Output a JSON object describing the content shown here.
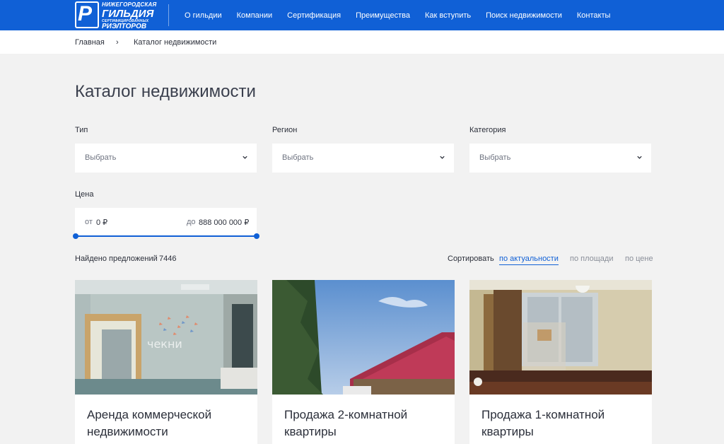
{
  "header": {
    "logo": {
      "mark": "P",
      "line1": "НИЖЕГОРОДСКАЯ",
      "line2": "ГИЛЬДИЯ",
      "line3": "СЕРТИФИЦИРОВАННЫХ",
      "line4": "РИЭЛТОРОВ"
    },
    "nav": [
      "О гильдии",
      "Компании",
      "Сертификация",
      "Преимущества",
      "Как вступить",
      "Поиск недвижимости",
      "Контакты"
    ]
  },
  "breadcrumb": {
    "home": "Главная",
    "separator": "›",
    "current": "Каталог недвижимости"
  },
  "page_title": "Каталог недвижимости",
  "filters": {
    "type": {
      "label": "Тип",
      "value": "Выбрать"
    },
    "region": {
      "label": "Регион",
      "value": "Выбрать"
    },
    "category": {
      "label": "Категория",
      "value": "Выбрать"
    },
    "price": {
      "label": "Цена",
      "from_label": "от",
      "from_value": "0 ₽",
      "to_label": "до",
      "to_value": "888 000 000 ₽"
    }
  },
  "results": {
    "found_label": "Найдено предложений",
    "count": "7446"
  },
  "sort": {
    "label": "Сортировать",
    "options": [
      "по актуальности",
      "по площади",
      "по цене"
    ],
    "active": "по актуальности"
  },
  "listings": [
    {
      "title": "Аренда коммерческой недвижимости",
      "watermark": "чекни"
    },
    {
      "title": "Продажа 2-комнатной квартиры"
    },
    {
      "title": "Продажа 1-комнатной квартиры"
    }
  ],
  "colors": {
    "brand": "#1060d6",
    "page_bg": "#f2f2f2",
    "text": "#2b2f3a"
  }
}
